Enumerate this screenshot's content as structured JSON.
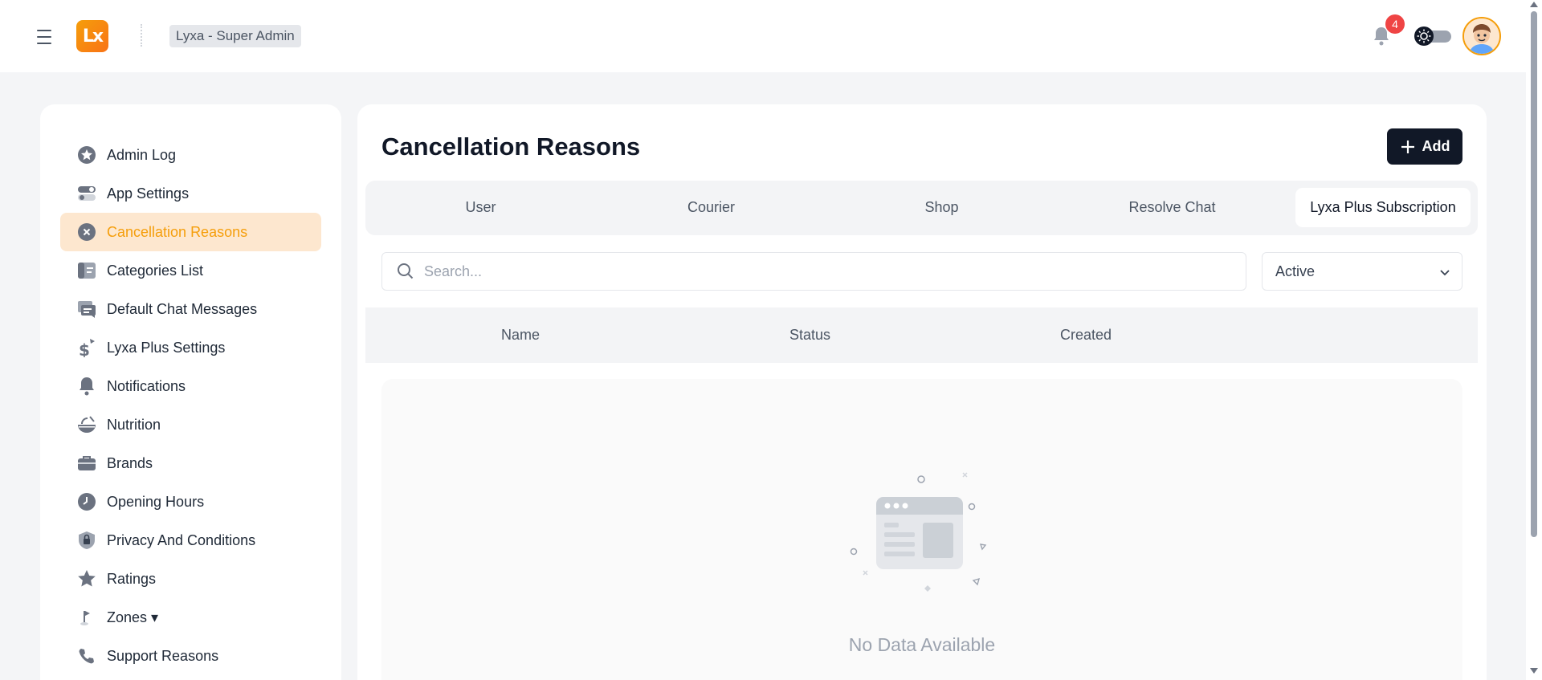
{
  "header": {
    "org_label": "Lyxa - Super Admin",
    "logo_text": "Lx",
    "notification_count": "4"
  },
  "sidebar": {
    "items": [
      {
        "label": "Admin Log",
        "icon": "star-badge-icon"
      },
      {
        "label": "App Settings",
        "icon": "toggles-icon"
      },
      {
        "label": "Cancellation Reasons",
        "icon": "cancel-circle-icon",
        "active": true
      },
      {
        "label": "Categories List",
        "icon": "categories-icon"
      },
      {
        "label": "Default Chat Messages",
        "icon": "chat-icon"
      },
      {
        "label": "Lyxa Plus Settings",
        "icon": "dollar-icon"
      },
      {
        "label": "Notifications",
        "icon": "bell-icon"
      },
      {
        "label": "Nutrition",
        "icon": "nutrition-icon"
      },
      {
        "label": "Brands",
        "icon": "briefcase-icon"
      },
      {
        "label": "Opening Hours",
        "icon": "clock-icon"
      },
      {
        "label": "Privacy And Conditions",
        "icon": "lock-shield-icon"
      },
      {
        "label": "Ratings",
        "icon": "star-icon"
      },
      {
        "label": "Zones ▾",
        "icon": "flag-icon"
      },
      {
        "label": "Support Reasons",
        "icon": "phone-icon"
      }
    ]
  },
  "main": {
    "title": "Cancellation Reasons",
    "add_label": "Add",
    "tabs": [
      {
        "label": "User"
      },
      {
        "label": "Courier"
      },
      {
        "label": "Shop"
      },
      {
        "label": "Resolve Chat"
      },
      {
        "label": "Lyxa Plus Subscription",
        "active": true
      }
    ],
    "search_placeholder": "Search...",
    "status_value": "Active",
    "columns": [
      "Name",
      "Status",
      "Created"
    ],
    "empty_text": "No Data Available"
  },
  "colors": {
    "accent": "#f59e0b",
    "active_bg": "#fde7cf",
    "primary_button": "#111827",
    "badge": "#ef4444"
  }
}
